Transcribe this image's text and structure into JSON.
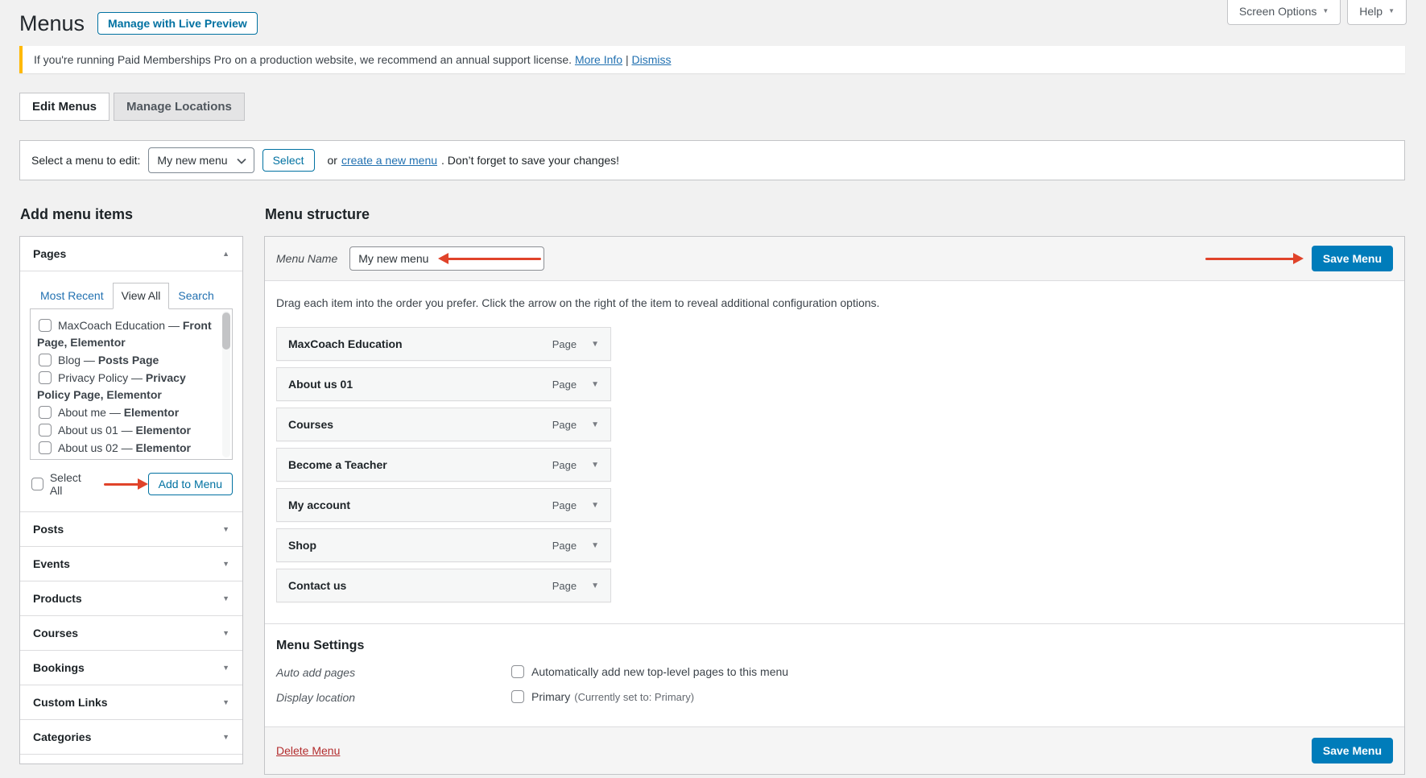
{
  "header": {
    "title": "Menus",
    "live_preview_button": "Manage with Live Preview",
    "screen_options_button": "Screen Options",
    "help_button": "Help"
  },
  "notice": {
    "text": "If you're running Paid Memberships Pro on a production website, we recommend an annual support license.",
    "more_info_link": "More Info",
    "separator": "|",
    "dismiss_link": "Dismiss"
  },
  "tabs": {
    "edit_menus": "Edit Menus",
    "manage_locations": "Manage Locations"
  },
  "menu_select": {
    "label": "Select a menu to edit:",
    "selected_value": "My new menu",
    "select_button": "Select",
    "or_text": "or",
    "create_link": "create a new menu",
    "after_link": ". Don’t forget to save your changes!"
  },
  "add_menu_items": {
    "heading": "Add menu items",
    "pages_panel": {
      "title": "Pages",
      "tabs": {
        "most_recent": "Most Recent",
        "view_all": "View All",
        "search": "Search"
      },
      "items": [
        {
          "text": "MaxCoach Education — ",
          "bold": "Front Page, Elementor"
        },
        {
          "text": "Blog — ",
          "bold": "Posts Page"
        },
        {
          "text": "Privacy Policy — ",
          "bold": "Privacy Policy Page, Elementor"
        },
        {
          "text": "About me — ",
          "bold": "Elementor"
        },
        {
          "text": "About us 01 — ",
          "bold": "Elementor"
        },
        {
          "text": "About us 02 — ",
          "bold": "Elementor"
        }
      ],
      "select_all_label": "Select All",
      "add_button": "Add to Menu"
    },
    "sections": [
      "Posts",
      "Events",
      "Products",
      "Courses",
      "Bookings",
      "Custom Links",
      "Categories"
    ]
  },
  "menu_structure": {
    "heading": "Menu structure",
    "name_label": "Menu Name",
    "name_value": "My new menu",
    "save_button": "Save Menu",
    "instruction": "Drag each item into the order you prefer. Click the arrow on the right of the item to reveal additional configuration options.",
    "items": [
      {
        "title": "MaxCoach Education",
        "type": "Page"
      },
      {
        "title": "About us 01",
        "type": "Page"
      },
      {
        "title": "Courses",
        "type": "Page"
      },
      {
        "title": "Become a Teacher",
        "type": "Page"
      },
      {
        "title": "My account",
        "type": "Page"
      },
      {
        "title": "Shop",
        "type": "Page"
      },
      {
        "title": "Contact us",
        "type": "Page"
      }
    ],
    "settings": {
      "heading": "Menu Settings",
      "auto_add_label": "Auto add pages",
      "auto_add_text": "Automatically add new top-level pages to this menu",
      "display_label": "Display location",
      "display_text": "Primary",
      "display_note": "(Currently set to: Primary)"
    },
    "delete_link": "Delete Menu"
  },
  "icons": {
    "caret_down": "▼",
    "caret_up": "▲"
  },
  "colors": {
    "accent_blue": "#007cba",
    "outline_button_blue": "#0071a1",
    "link_blue": "#2271b1",
    "annotation_arrow_red": "#e0432a",
    "notice_yellow": "#ffb900",
    "delete_red": "#b32d2e",
    "page_background": "#f1f1f1"
  }
}
